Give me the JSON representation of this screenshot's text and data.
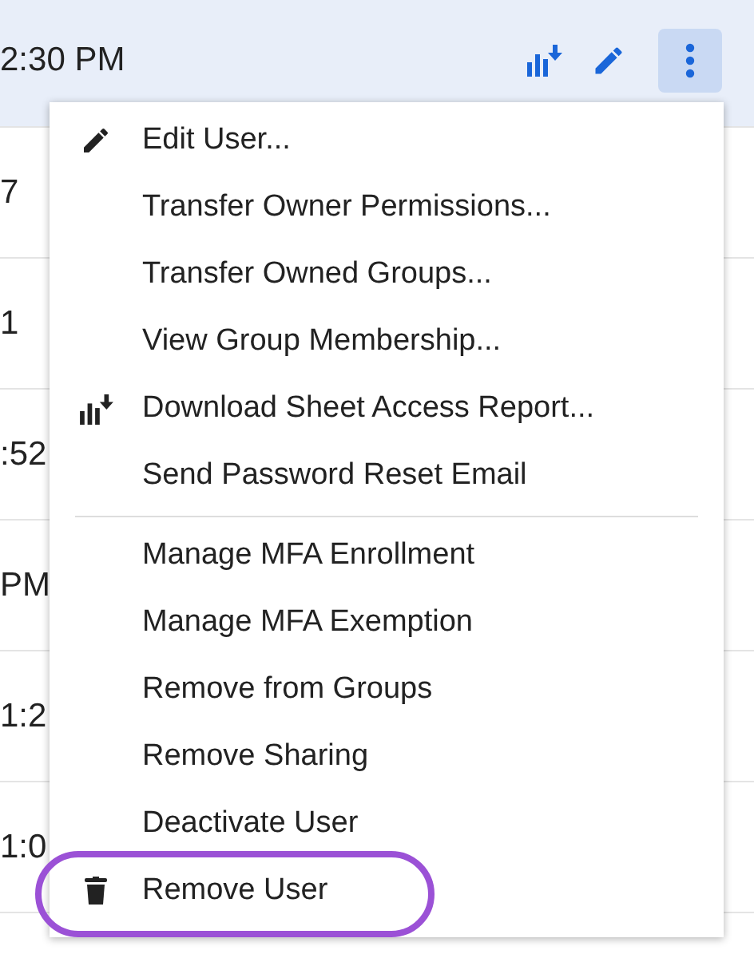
{
  "rows": [
    {
      "time": "2:30 PM",
      "selected": true
    },
    {
      "time": "7",
      "selected": false
    },
    {
      "time": "1",
      "selected": false
    },
    {
      "time": ":52",
      "selected": false
    },
    {
      "time": "PM",
      "selected": false
    },
    {
      "time": "1:2",
      "selected": false
    },
    {
      "time": "1:0",
      "selected": false
    }
  ],
  "row_actions": {
    "more_active": true
  },
  "menu": {
    "sections": [
      [
        {
          "label": "Edit User...",
          "kind": "edit",
          "highlighted": false
        },
        {
          "label": "Transfer Owner Permissions...",
          "kind": "plain",
          "highlighted": false
        },
        {
          "label": "Transfer Owned Groups...",
          "kind": "plain",
          "highlighted": false
        },
        {
          "label": "View Group Membership...",
          "kind": "plain",
          "highlighted": false
        },
        {
          "label": "Download Sheet Access Report...",
          "kind": "report",
          "highlighted": false
        },
        {
          "label": "Send Password Reset Email",
          "kind": "plain",
          "highlighted": false
        }
      ],
      [
        {
          "label": "Manage MFA Enrollment",
          "kind": "plain",
          "highlighted": false
        },
        {
          "label": "Manage MFA Exemption",
          "kind": "plain",
          "highlighted": false
        },
        {
          "label": "Remove from Groups",
          "kind": "plain",
          "highlighted": false
        },
        {
          "label": "Remove Sharing",
          "kind": "plain",
          "highlighted": false
        },
        {
          "label": "Deactivate User",
          "kind": "plain",
          "highlighted": false
        },
        {
          "label": "Remove User",
          "kind": "delete",
          "highlighted": true
        }
      ]
    ]
  }
}
